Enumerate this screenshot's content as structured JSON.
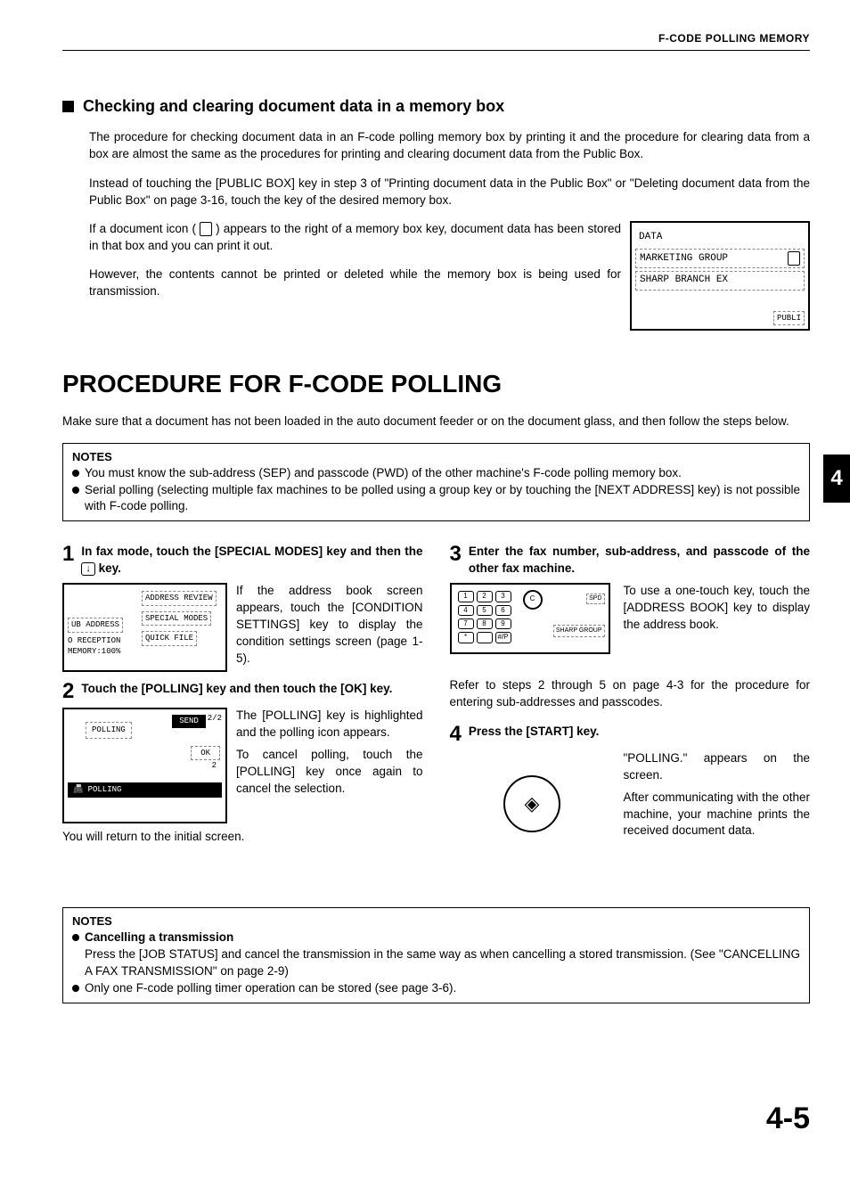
{
  "header": "F-CODE POLLING MEMORY",
  "sec1": {
    "title": "Checking and clearing document data in a memory box",
    "p1": "The procedure for checking document data in an F-code polling memory box by printing it and the procedure for clearing data from a box are almost the same as the procedures for printing and clearing document data from the Public Box.",
    "p2": "Instead of touching the [PUBLIC BOX] key in step 3 of \"Printing document data in the Public Box\" or \"Deleting document data from the Public Box\" on page 3-16, touch the key of the desired memory box.",
    "p3a": "If a document icon (",
    "p3b": ") appears to the right of a memory box key, document data has been stored in that box and you can print it out.",
    "p4": "However, the contents cannot be printed or deleted while the memory box is being used for transmission."
  },
  "fig1": {
    "data": "DATA",
    "row1": "MARKETING GROUP",
    "row2": "SHARP BRANCH EX",
    "tag": "PUBLI"
  },
  "proc": {
    "title": "PROCEDURE FOR F-CODE POLLING",
    "intro": "Make sure that a document has not been loaded in the auto document feeder or on the document glass, and then follow the steps below."
  },
  "tab": "4",
  "notes1": {
    "title": "NOTES",
    "b1": "You must know the sub-address (SEP) and passcode (PWD) of the other machine's F-code polling memory box.",
    "b2": "Serial polling (selecting multiple fax machines to be polled using a group key or by touching the [NEXT ADDRESS] key) is not possible with F-code polling."
  },
  "step1": {
    "num": "1",
    "title_a": "In fax mode, touch the [SPECIAL MODES] key and then the ",
    "title_b": " key.",
    "text": "If the address book screen appears, touch the [CONDITION SETTINGS] key to display the condition settings screen (page 1-5).",
    "panel": {
      "a": "ADDRESS REVIEW",
      "b": "SPECIAL MODES",
      "c": "QUICK FILE",
      "d": "UB ADDRESS",
      "e": "O RECEPTION",
      "f": "MEMORY:100%"
    }
  },
  "step2": {
    "num": "2",
    "title": "Touch the [POLLING] key and then touch the [OK] key.",
    "text": "The [POLLING] key is highlighted and the polling icon appears.",
    "text2": "To cancel polling, touch the [POLLING] key once again to cancel the selection.",
    "after": "You will return to the initial screen.",
    "panel": {
      "poll": "POLLING",
      "send": "SEND",
      "ok": "OK",
      "count1": "2/2",
      "count2": "2",
      "bar": "POLLING"
    }
  },
  "step3": {
    "num": "3",
    "title": "Enter the fax number, sub-address, and passcode of the other fax machine.",
    "text": "To use a one-touch key, touch the [ADDRESS BOOK] key to display the address book.",
    "text2": "Refer to steps 2 through 5 on page 4-3 for the procedure for entering sub-addresses and passcodes.",
    "panel": {
      "keys": [
        "1",
        "2",
        "3",
        "4",
        "5",
        "6",
        "7",
        "8",
        "9",
        "*",
        " ",
        "#/P"
      ],
      "grp": "SHARP GROUP",
      "spd": "SPD"
    }
  },
  "step4": {
    "num": "4",
    "title": "Press the [START] key.",
    "text": "\"POLLING.\" appears on the screen.",
    "text2": "After communicating with the other machine, your machine prints the received document data."
  },
  "notes2": {
    "title": "NOTES",
    "b1t": "Cancelling a transmission",
    "b1": "Press the [JOB STATUS] and cancel the transmission in the same way as when cancelling a stored transmission. (See \"CANCELLING A FAX TRANSMISSION\" on page  2-9)",
    "b2": "Only one F-code polling timer operation can be stored (see page 3-6)."
  },
  "pagenum": "4-5"
}
